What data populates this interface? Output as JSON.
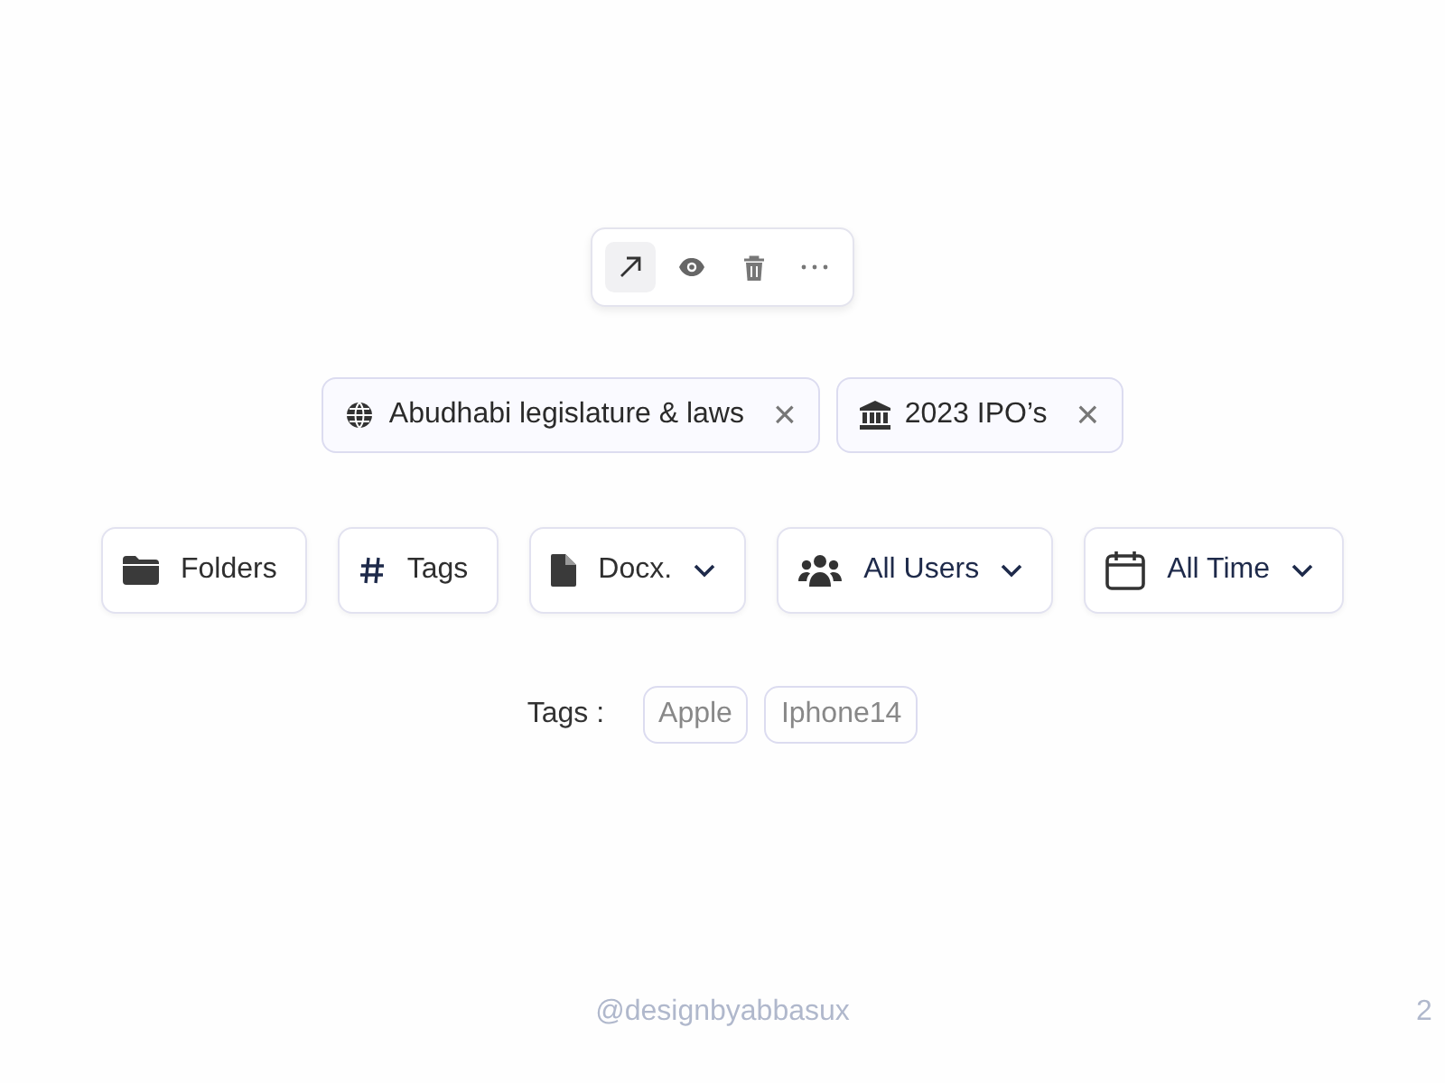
{
  "toolbar": {
    "actions": [
      {
        "selected": true
      },
      {
        "selected": false
      },
      {
        "selected": false
      },
      {
        "selected": false
      }
    ]
  },
  "chips": [
    {
      "label": "Abudhabi legislature & laws",
      "remove": "×"
    },
    {
      "label": "2023 IPO’s",
      "remove": "×"
    }
  ],
  "filters": [
    {
      "label": "Folders",
      "kind": "button"
    },
    {
      "label": "Tags",
      "kind": "button"
    },
    {
      "label": "Docx.",
      "kind": "dropdown"
    },
    {
      "label": "All Users",
      "kind": "dropdown"
    },
    {
      "label": "All Time",
      "kind": "dropdown"
    }
  ],
  "tags": {
    "label": "Tags :",
    "items": [
      "Apple",
      "Iphone14"
    ]
  },
  "footer": {
    "credit": "@designbyabbasux",
    "page": "2"
  }
}
